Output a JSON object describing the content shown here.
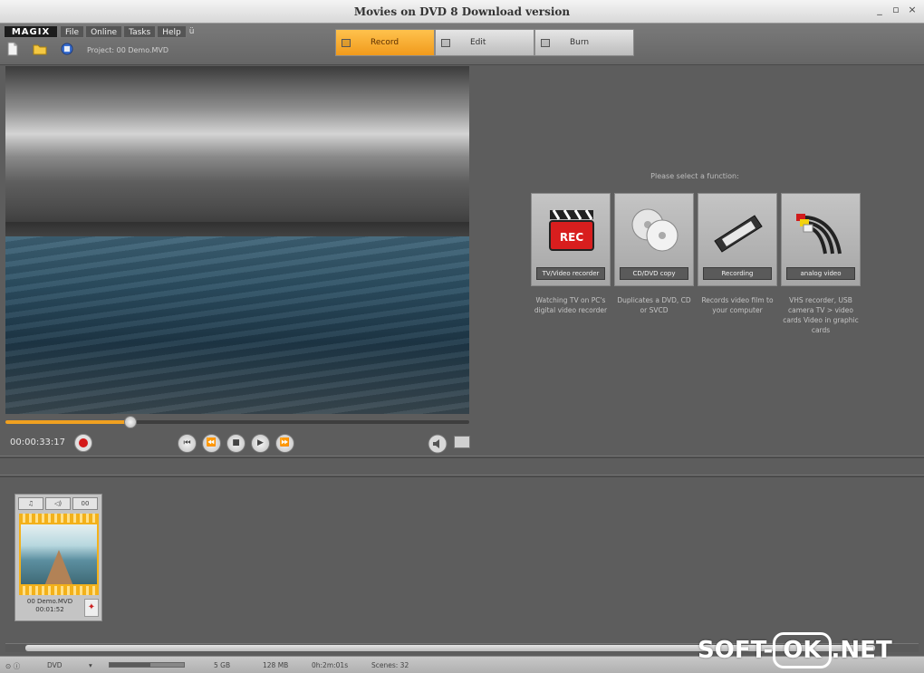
{
  "window": {
    "title": "Movies on DVD 8 Download version",
    "minimize": "_",
    "restore": "▫",
    "close": "×"
  },
  "brand": {
    "logo": "MAGIX"
  },
  "menu": {
    "items": [
      "File",
      "Online",
      "Tasks",
      "Help"
    ],
    "extra": "ü"
  },
  "toolbar": {
    "project_label": "Project: 00 Demo.MVD"
  },
  "modes": [
    {
      "label": "Record",
      "active": true
    },
    {
      "label": "Edit",
      "active": false
    },
    {
      "label": "Burn",
      "active": false
    }
  ],
  "player": {
    "timecode": "00:00:33:17",
    "position_fraction": 0.27,
    "transport": [
      "⏮",
      "⏪",
      "■",
      "▶",
      "⏩"
    ]
  },
  "functions": {
    "prompt": "Please select a function:",
    "items": [
      {
        "label": "TV/Video recorder",
        "description": "Watching TV on PC's digital video recorder"
      },
      {
        "label": "CD/DVD copy",
        "description": "Duplicates a DVD, CD or SVCD"
      },
      {
        "label": "Recording",
        "description": "Records video film to your computer"
      },
      {
        "label": "analog video",
        "description": "VHS recorder, USB camera TV > video cards Video in graphic cards"
      }
    ]
  },
  "storyboard": {
    "clips": [
      {
        "title": "00 Demo.MVD",
        "duration": "00:01:52",
        "buttons": [
          "♫",
          "◁)",
          "00"
        ]
      }
    ]
  },
  "status": {
    "format": "DVD",
    "usage_fraction": 0.55,
    "size_gb": "5 GB",
    "size_mb": "128 MB",
    "duration": "0h:2m:01s",
    "scenes": "Scenes: 32"
  },
  "watermark": {
    "left": "SOFT-",
    "ok": "OK",
    "right": ".NET"
  },
  "colors": {
    "accent": "#f09a1c",
    "record": "#d41818",
    "panel": "#5d5d5d"
  }
}
